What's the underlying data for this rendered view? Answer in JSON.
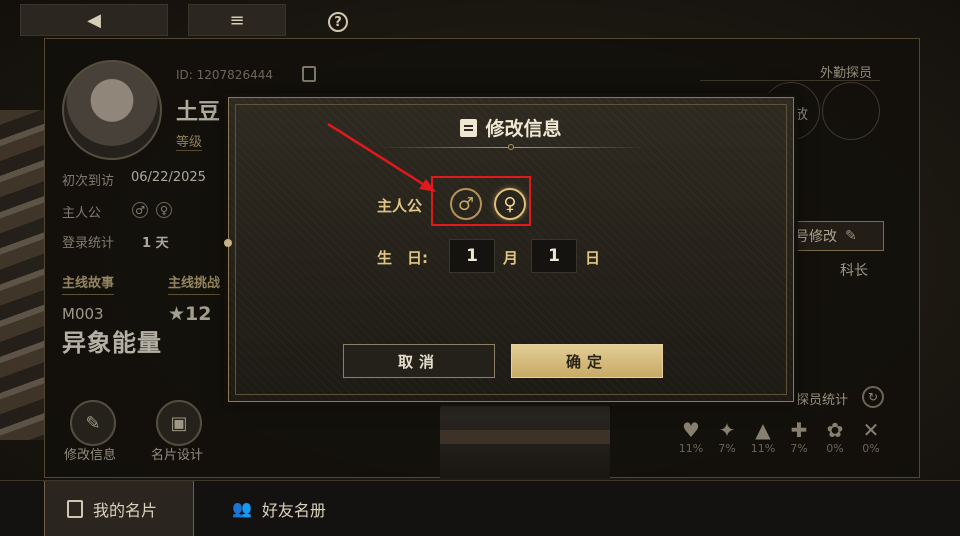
{
  "top": {
    "back_icon": "◀",
    "menu_icon": "≡",
    "help_icon": "?"
  },
  "profile": {
    "id": "ID: 1207826444",
    "name": "土豆",
    "level_label": "等级",
    "first_visit_label": "初次到访",
    "first_visit_value": "06/22/2025",
    "protagonist_label": "主人公",
    "login_stats_label": "登录统计",
    "login_stats_value": "1 天",
    "main_story_label": "主线故事",
    "main_challenge_label": "主线挑战",
    "mission_code": "M003",
    "mission_name": "异象能量",
    "stars": "★12",
    "edit_info_label": "修改信息",
    "card_design_label": "名片设计"
  },
  "right": {
    "field_agent_label": "外勤探员",
    "release_text": "放",
    "codename_button": "号修改",
    "rank": "科长",
    "agent_stats_label": "探员统计",
    "stats": [
      {
        "icon": "heart-gem-icon",
        "glyph": "♥",
        "pct": "11%"
      },
      {
        "icon": "star-gem-icon",
        "glyph": "✦",
        "pct": "7%"
      },
      {
        "icon": "chevron-gem-icon",
        "glyph": "▲",
        "pct": "11%"
      },
      {
        "icon": "cross-gem-icon",
        "glyph": "✚",
        "pct": "7%"
      },
      {
        "icon": "flower-gem-icon",
        "glyph": "✿",
        "pct": "0%"
      },
      {
        "icon": "wing-gem-icon",
        "glyph": "✕",
        "pct": "0%"
      }
    ]
  },
  "bottom": {
    "tabs": [
      {
        "label": "我的名片",
        "active": true
      },
      {
        "label": "好友名册",
        "active": false
      }
    ]
  },
  "dialog": {
    "title": "修改信息",
    "protagonist_label": "主人公",
    "male_symbol": "♂",
    "female_symbol": "♀",
    "selected_sex": "female",
    "birthday_label": "生　日:",
    "month_value": "1",
    "month_unit": "月",
    "day_value": "1",
    "day_unit": "日",
    "cancel_label": "取消",
    "confirm_label": "确定"
  },
  "colors": {
    "accent_gold": "#e1c583",
    "confirm_fill": "#d6bd7d",
    "highlight_red": "#e0191c"
  }
}
